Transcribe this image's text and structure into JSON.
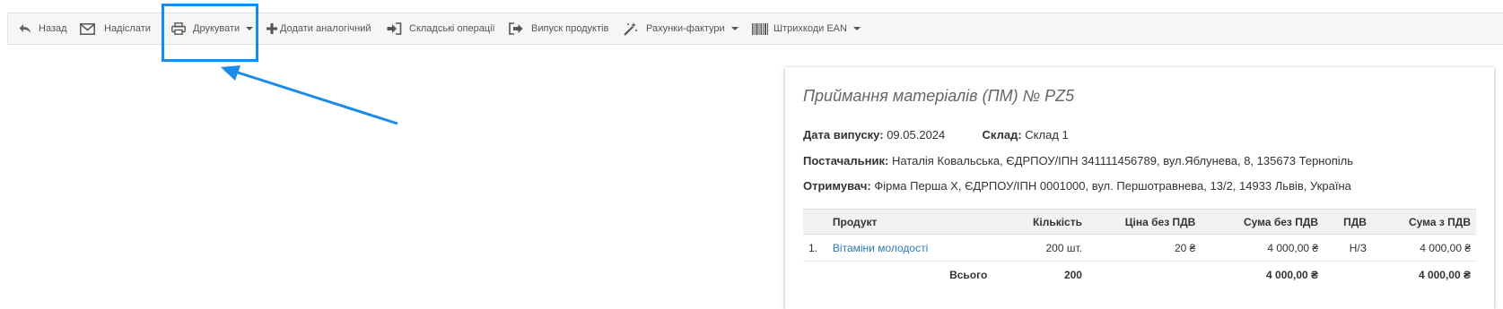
{
  "toolbar": {
    "back": "Назад",
    "send": "Надіслати",
    "print": "Друкувати",
    "add_similar": "Додати аналогічний",
    "warehouse_ops": "Складські операції",
    "product_issue": "Випуск продуктів",
    "invoices": "Рахунки-фактури",
    "ean_barcodes": "Штрихкоди EAN"
  },
  "document": {
    "title": "Приймання матеріалів (ПМ) № PZ5",
    "issue_date_label": "Дата випуску:",
    "issue_date": "09.05.2024",
    "warehouse_label": "Склад:",
    "warehouse": "Склад 1",
    "supplier_label": "Постачальник:",
    "supplier": "Наталія Ковальська, ЄДРПОУ/ІПН 341111456789, вул.Яблунева, 8, 135673 Тернопіль",
    "recipient_label": "Отримувач:",
    "recipient": "Фірма Перша Х, ЄДРПОУ/ІПН 0001000, вул. Першотравнева, 13/2, 14933 Львів, Україна"
  },
  "table": {
    "headers": {
      "product": "Продукт",
      "qty": "Кількість",
      "price_net": "Ціна без ПДВ",
      "sum_net": "Сума без ПДВ",
      "vat": "ПДВ",
      "sum_gross": "Сума з ПДВ"
    },
    "rows": [
      {
        "index": "1.",
        "product": "Вітаміни молодості",
        "qty": "200 шт.",
        "price_net": "20 ₴",
        "sum_net": "4 000,00 ₴",
        "vat": "Н/З",
        "sum_gross": "4 000,00 ₴"
      }
    ],
    "total": {
      "label": "Всього",
      "qty": "200",
      "sum_net": "4 000,00 ₴",
      "sum_gross": "4 000,00 ₴"
    }
  },
  "colors": {
    "highlight": "#1a8be8",
    "link": "#2a7ab8"
  }
}
